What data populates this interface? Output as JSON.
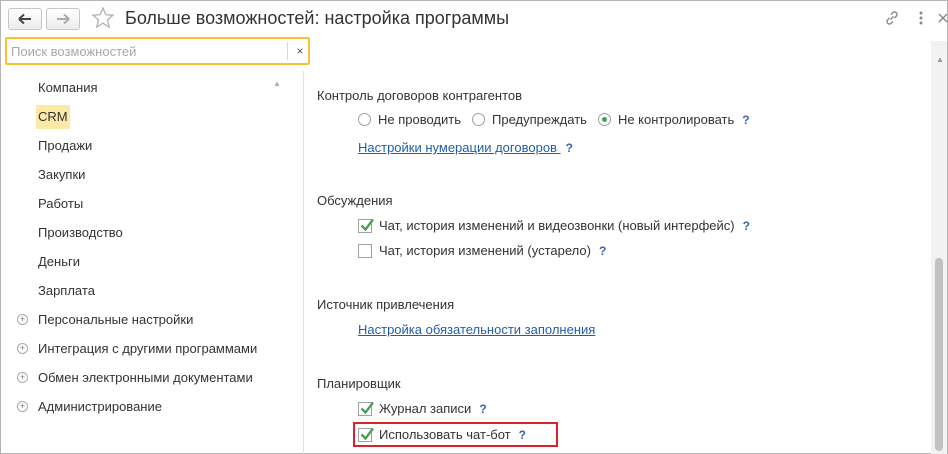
{
  "window": {
    "title": "Больше возможностей: настройка программы",
    "icons": {
      "back": "arrow-left-icon",
      "forward": "arrow-right-icon",
      "favorite": "star-icon",
      "link": "link-icon",
      "more": "more-icon",
      "close": "close-icon"
    }
  },
  "search": {
    "placeholder": "Поиск возможностей",
    "value": "",
    "clear_label": "×"
  },
  "sidebar": {
    "items": [
      {
        "label": "Компания",
        "expandable": false,
        "selected": false
      },
      {
        "label": "CRM",
        "expandable": false,
        "selected": true
      },
      {
        "label": "Продажи",
        "expandable": false,
        "selected": false
      },
      {
        "label": "Закупки",
        "expandable": false,
        "selected": false
      },
      {
        "label": "Работы",
        "expandable": false,
        "selected": false
      },
      {
        "label": "Производство",
        "expandable": false,
        "selected": false
      },
      {
        "label": "Деньги",
        "expandable": false,
        "selected": false
      },
      {
        "label": "Зарплата",
        "expandable": false,
        "selected": false
      },
      {
        "label": "Персональные настройки",
        "expandable": true,
        "selected": false
      },
      {
        "label": "Интеграция с другими программами",
        "expandable": true,
        "selected": false
      },
      {
        "label": "Обмен электронными документами",
        "expandable": true,
        "selected": false
      },
      {
        "label": "Администрирование",
        "expandable": true,
        "selected": false
      }
    ]
  },
  "main": {
    "contracts": {
      "title": "Контроль договоров контрагентов",
      "options": [
        {
          "label": "Не проводить",
          "checked": false
        },
        {
          "label": "Предупреждать",
          "checked": false
        },
        {
          "label": "Не контролировать",
          "checked": true
        }
      ],
      "help": "?",
      "numbering_link": "Настройки нумерации договоров",
      "numbering_help": "?"
    },
    "discussions": {
      "title": "Обсуждения",
      "options": [
        {
          "label": "Чат, история изменений и видеозвонки (новый интерфейс)",
          "checked": true,
          "help": "?"
        },
        {
          "label": "Чат, история изменений (устарело)",
          "checked": false,
          "help": "?"
        }
      ]
    },
    "source": {
      "title": "Источник привлечения",
      "link": "Настройка обязательности заполнения"
    },
    "planner": {
      "title": "Планировщик",
      "options": [
        {
          "label": "Журнал записи",
          "checked": true,
          "help": "?"
        },
        {
          "label": "Использовать чат-бот",
          "checked": true,
          "help": "?"
        }
      ]
    }
  },
  "colors": {
    "accent_check": "#4a9d55",
    "search_border": "#f4c236",
    "selection_bg": "#fbe9a4",
    "link": "#1f5fa8",
    "highlight": "#d9222a"
  }
}
